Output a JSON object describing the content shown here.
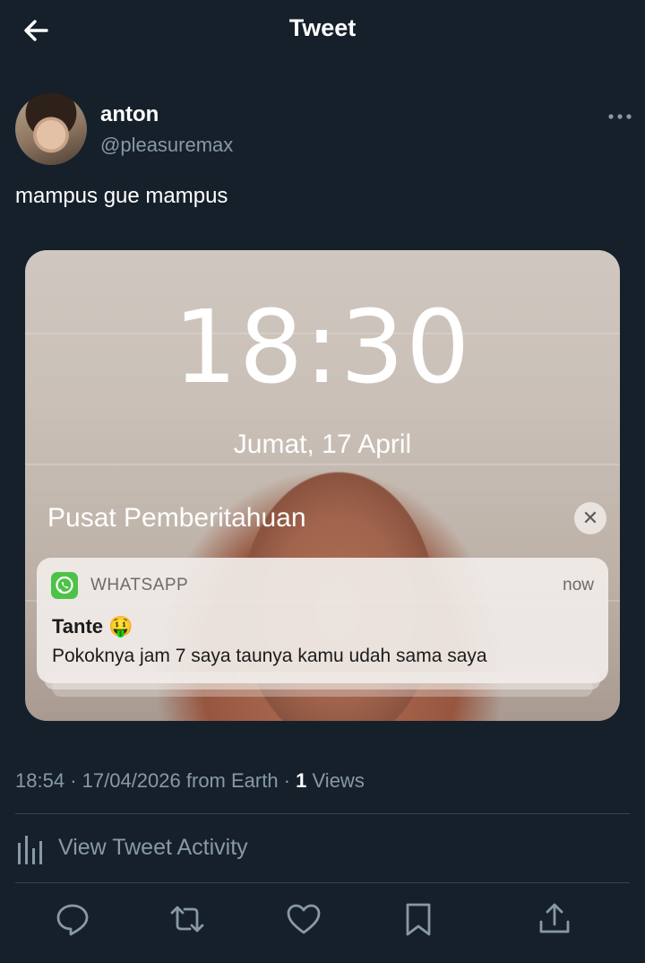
{
  "header": {
    "title": "Tweet"
  },
  "author": {
    "name": "anton",
    "handle": "@pleasuremax"
  },
  "tweet": {
    "text": "mampus gue mampus"
  },
  "media": {
    "lock_time": "18:30",
    "lock_date": "Jumat, 17 April",
    "notification_center_label": "Pusat Pemberitahuan",
    "notification": {
      "app": "WHATSAPP",
      "time": "now",
      "title": "Tante 🤑",
      "body": "Pokoknya jam 7 saya taunya kamu udah sama saya"
    }
  },
  "meta": {
    "time": "18:54",
    "date": "17/04/2026",
    "source": "from Earth",
    "views_count": "1",
    "views_label": "Views"
  },
  "activity": {
    "label": "View Tweet Activity"
  },
  "actions": [
    "reply-icon",
    "retweet-icon",
    "like-icon",
    "bookmark-icon",
    "share-icon"
  ],
  "colors": {
    "background": "#15202b",
    "secondary_text": "#8899a6",
    "divider": "#38444d",
    "whatsapp_green": "#4dc247"
  }
}
